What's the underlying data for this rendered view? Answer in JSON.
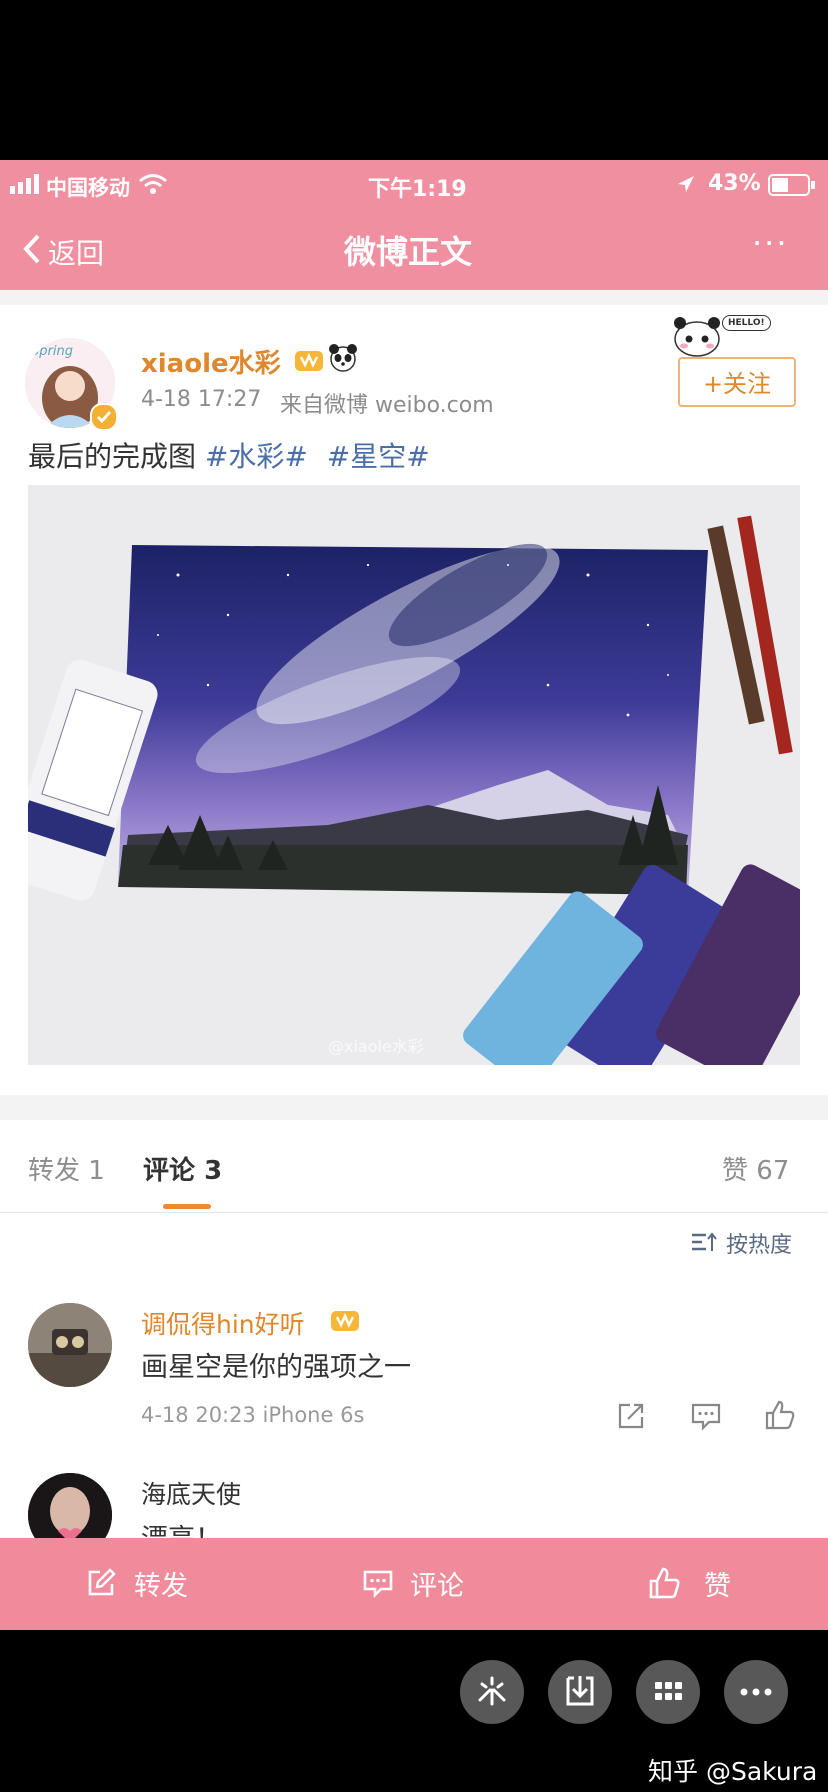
{
  "status": {
    "carrier": "中国移动",
    "time": "下午1:19",
    "battery": "43%"
  },
  "nav": {
    "back_label": "返回",
    "title": "微博正文",
    "more_label": "···"
  },
  "post": {
    "username": "xiaole水彩",
    "timestamp": "4-18 17:27",
    "source": "来自微博 weibo.com",
    "follow_label": "+关注",
    "hello_bubble": "HELLO!",
    "text_main": "最后的完成图",
    "tag1": "#水彩#",
    "tag2": "#星空#",
    "avatar_text": "Spring",
    "watermark": "@xiaole水彩"
  },
  "tabs": {
    "repost_label": "转发",
    "repost_count": "1",
    "comment_label": "评论",
    "comment_count": "3",
    "like_label": "赞",
    "like_count": "67"
  },
  "sort_label": "按热度",
  "comments": [
    {
      "username": "调侃得hin好听",
      "text": "画星空是你的强项之一",
      "meta": "4-18 20:23  iPhone 6s"
    },
    {
      "username": "海底天使",
      "text": "漂亮！"
    }
  ],
  "toolbar": {
    "repost": "转发",
    "comment": "评论",
    "like": "赞"
  },
  "watermark_footer": "知乎 @Sakura",
  "colors": {
    "brand_pink": "#ef8f9f",
    "username_orange": "#e0862b",
    "link_blue": "#4a6fa8"
  }
}
